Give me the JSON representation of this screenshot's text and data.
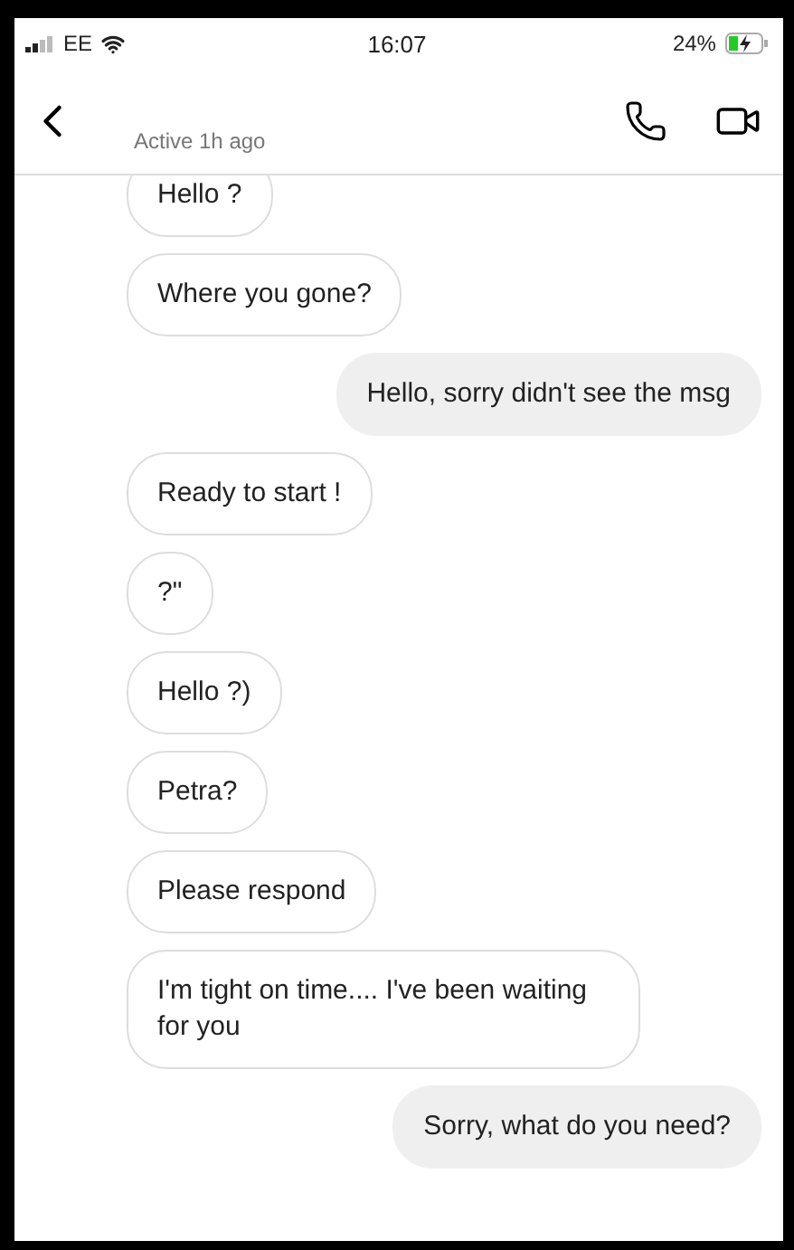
{
  "status_bar": {
    "carrier": "EE",
    "time": "16:07",
    "battery": "24%"
  },
  "header": {
    "subtitle": "Active 1h ago"
  },
  "messages": [
    {
      "text": "Hello ?",
      "outgoing": false
    },
    {
      "text": "Where you gone?",
      "outgoing": false
    },
    {
      "text": "Hello, sorry didn't see the msg",
      "outgoing": true
    },
    {
      "text": "Ready to start !",
      "outgoing": false
    },
    {
      "text": "?\"",
      "outgoing": false
    },
    {
      "text": "Hello ?)",
      "outgoing": false
    },
    {
      "text": "Petra?",
      "outgoing": false
    },
    {
      "text": "Please respond",
      "outgoing": false
    },
    {
      "text": "I'm tight on time.... I've been waiting for you",
      "outgoing": false
    },
    {
      "text": "Sorry, what do you need?",
      "outgoing": true
    }
  ]
}
